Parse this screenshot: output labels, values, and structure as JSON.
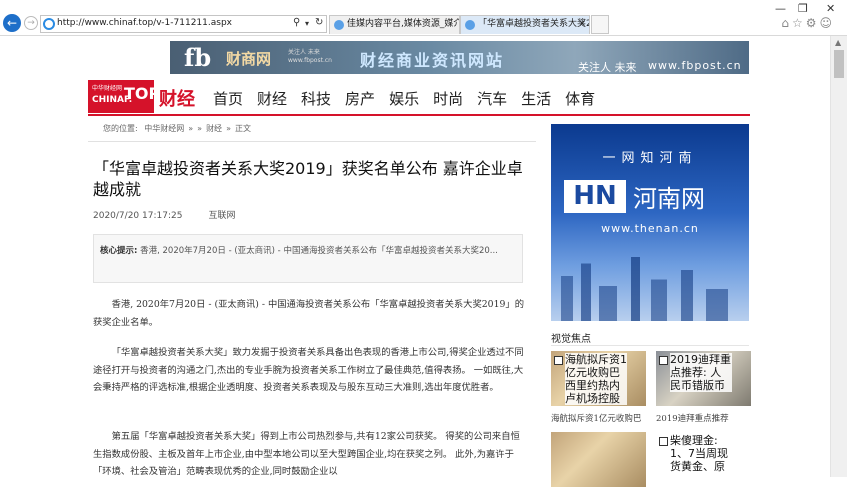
{
  "browser": {
    "url": "http://www.chinaf.top/v-1-711211.aspx",
    "search_icon": "search-icon",
    "tabs": [
      {
        "label": "佳媒内容平台,媒体资源_媒介资..."
      },
      {
        "label": "「华富卓越投资者关系大奖2..."
      }
    ],
    "window_buttons": [
      "—",
      "❐",
      "✕"
    ],
    "toolbar_icons": "⌂☆⚙☺"
  },
  "banner": {
    "fb": "fb",
    "brand": "财商网",
    "small_line1": "关注人 未来",
    "small_line2": "www.fbpost.cn",
    "center": "财经商业资讯网站",
    "slogan": "关注人 未来",
    "site": "www.fbpost.cn"
  },
  "logo": {
    "line1": "中华财经网",
    "line2": "CHINAF.",
    "big": "TOP",
    "name": "财经"
  },
  "nav": [
    "首页",
    "财经",
    "科技",
    "房产",
    "娱乐",
    "时尚",
    "汽车",
    "生活",
    "体育"
  ],
  "breadcrumb": {
    "prefix": "您的位置: ",
    "home": "中华财经网",
    "sep1": "»",
    "sep2": "»",
    "section": "财经",
    "sep3": "»",
    "current": "正文"
  },
  "article": {
    "title": "「华富卓越投资者关系大奖2019」获奖名单公布 嘉许企业卓越成就",
    "date": "2020/7/20 17:17:25",
    "source": "互联网",
    "summary_label": "核心提示:",
    "summary": "香港, 2020年7月20日 - (亚太商讯) - 中国通海投资者关系公布「华富卓越投资者关系大奖20...",
    "paragraphs": [
      "香港, 2020年7月20日 - (亚太商讯) - 中国通海投资者关系公布「华富卓越投资者关系大奖2019」的获奖企业名单。",
      "「华富卓越投资者关系大奖」致力发掘于投资者关系具备出色表现的香港上市公司,得奖企业透过不同途径打开与投资者的沟通之门,杰出的专业手腕为投资者关系工作树立了最佳典范,值得表扬。 一如既往,大会秉持严格的评选标准,根据企业透明度、投资者关系表现及与股东互动三大准则,选出年度优胜者。",
      "第五届「华富卓越投资者关系大奖」得到上市公司热烈参与,共有12家公司获奖。 得奖的公司来自恒生指数成份股、主板及首年上市企业,由中型本地公司以至大型跨国企业,均在获奖之列。 此外,为嘉许于「环境、社会及管治」范畴表现优秀的企业,同时鼓励企业以"
    ]
  },
  "sidebar": {
    "ad": {
      "tagline": "一网知河南",
      "mark": "HN",
      "name": "河南网",
      "url": "www.thenan.cn"
    },
    "section_title": "视觉焦点",
    "items": [
      {
        "caption": "海航拟斥资1亿元收购巴西里约热内卢机场控股",
        "label": "海航拟斥资1亿元收购巴"
      },
      {
        "caption": "2019迪拜重点推荐: 人民币错版币",
        "label": "2019迪拜重点推荐"
      },
      {
        "caption": "柴傻理金: 1、7当周现货黄金、原",
        "label": ""
      }
    ]
  }
}
